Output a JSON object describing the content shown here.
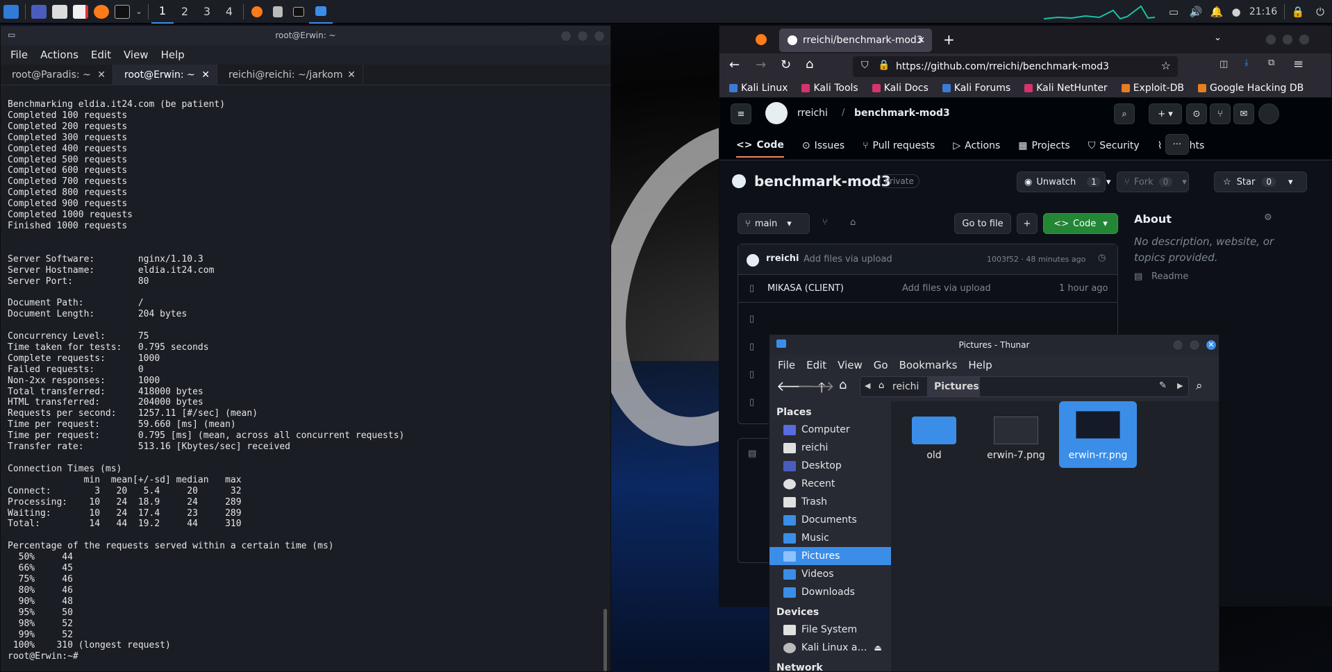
{
  "panel": {
    "workspaces": [
      "1",
      "2",
      "3",
      "4"
    ],
    "clock": "21:16"
  },
  "terminal": {
    "title": "root@Erwin: ~",
    "menu": [
      "File",
      "Actions",
      "Edit",
      "View",
      "Help"
    ],
    "tabs": [
      "root@Paradis: ~",
      "root@Erwin: ~",
      "reichi@reichi: ~/jarkom"
    ],
    "output": "Benchmarking eldia.it24.com (be patient)\nCompleted 100 requests\nCompleted 200 requests\nCompleted 300 requests\nCompleted 400 requests\nCompleted 500 requests\nCompleted 600 requests\nCompleted 700 requests\nCompleted 800 requests\nCompleted 900 requests\nCompleted 1000 requests\nFinished 1000 requests\n\n\nServer Software:        nginx/1.10.3\nServer Hostname:        eldia.it24.com\nServer Port:            80\n\nDocument Path:          /\nDocument Length:        204 bytes\n\nConcurrency Level:      75\nTime taken for tests:   0.795 seconds\nComplete requests:      1000\nFailed requests:        0\nNon-2xx responses:      1000\nTotal transferred:      418000 bytes\nHTML transferred:       204000 bytes\nRequests per second:    1257.11 [#/sec] (mean)\nTime per request:       59.660 [ms] (mean)\nTime per request:       0.795 [ms] (mean, across all concurrent requests)\nTransfer rate:          513.16 [Kbytes/sec] received\n\nConnection Times (ms)\n              min  mean[+/-sd] median   max\nConnect:        3   20   5.4     20      32\nProcessing:    10   24  18.9     24     289\nWaiting:       10   24  17.4     23     289\nTotal:         14   44  19.2     44     310\n\nPercentage of the requests served within a certain time (ms)\n  50%     44\n  66%     45\n  75%     46\n  80%     46\n  90%     48\n  95%     50\n  98%     52\n  99%     52\n 100%    310 (longest request)\nroot@Erwin:~# "
  },
  "firefox": {
    "tab_title": "rreichi/benchmark-mod3",
    "url": "https://github.com/rreichi/benchmark-mod3",
    "bookmarks": [
      "Kali Linux",
      "Kali Tools",
      "Kali Docs",
      "Kali Forums",
      "Kali NetHunter",
      "Exploit-DB",
      "Google Hacking DB"
    ]
  },
  "github": {
    "owner": "rreichi",
    "repo": "benchmark-mod3",
    "nav": [
      "Code",
      "Issues",
      "Pull requests",
      "Actions",
      "Projects",
      "Security",
      "Insights"
    ],
    "visibility": "Private",
    "unwatch": "Unwatch",
    "watch_count": "1",
    "fork": "Fork",
    "fork_count": "0",
    "star": "Star",
    "star_count": "0",
    "branch": "main",
    "go_to_file": "Go to file",
    "code_btn": "Code",
    "commit_author": "rreichi",
    "commit_msg": "Add files via upload",
    "commit_meta": "1003f52 · 48 minutes ago",
    "files": [
      {
        "name": "MIKASA (CLIENT)",
        "msg": "Add files via upload",
        "time": "1 hour ago"
      }
    ],
    "about_title": "About",
    "about_text": "No description, website, or topics provided.",
    "readme": "Readme"
  },
  "thunar": {
    "title": "Pictures - Thunar",
    "menu": [
      "File",
      "Edit",
      "View",
      "Go",
      "Bookmarks",
      "Help"
    ],
    "path": [
      "reichi",
      "Pictures"
    ],
    "places_h": "Places",
    "places": [
      "Computer",
      "reichi",
      "Desktop",
      "Recent",
      "Trash",
      "Documents",
      "Music",
      "Pictures",
      "Videos",
      "Downloads"
    ],
    "devices_h": "Devices",
    "devices": [
      "File System",
      "Kali Linux a…"
    ],
    "network_h": "Network",
    "files": [
      "old",
      "erwin-7.png",
      "erwin-rr.png"
    ]
  },
  "colors": {
    "accent": "#3b8ee8",
    "gh_green": "#238636"
  }
}
